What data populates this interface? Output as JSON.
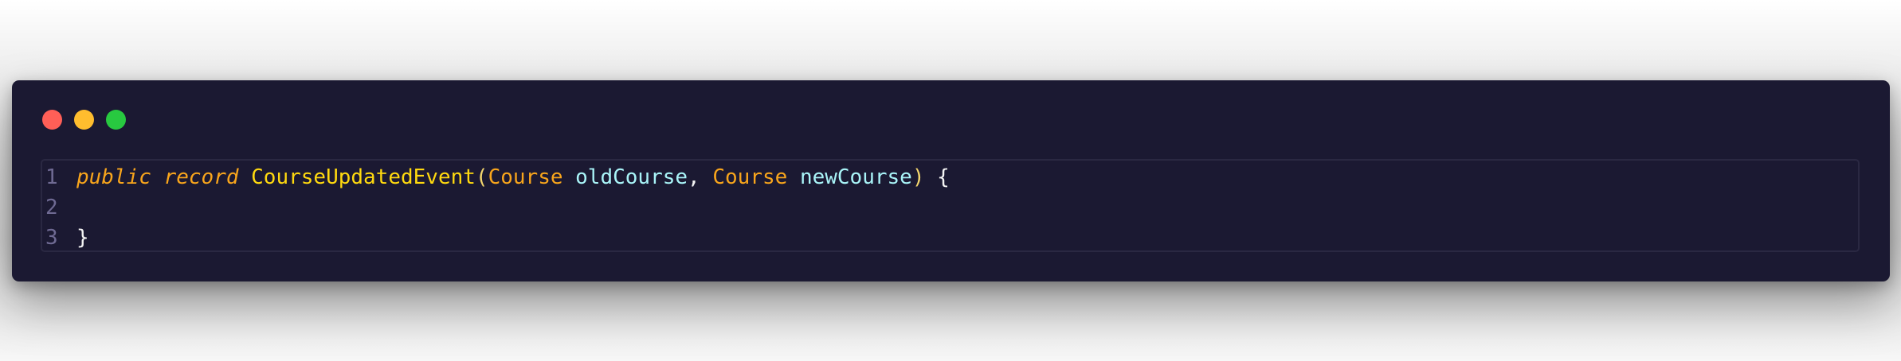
{
  "window": {
    "controls": [
      {
        "name": "close",
        "color": "#ff5f57"
      },
      {
        "name": "minimize",
        "color": "#ffbd2e"
      },
      {
        "name": "zoom",
        "color": "#28c940"
      }
    ]
  },
  "colors": {
    "window_bg": "#1b1932",
    "line_number": "#6f6a93",
    "keyword": "#f8a51c",
    "class_name": "#ffd90f",
    "type": "#f8a51c",
    "param": "#a9f4f8",
    "punct": "#f5d76e",
    "text": "#f4f4f4"
  },
  "code": {
    "lines": [
      {
        "number": "1",
        "tokens": {
          "kw_public": "public",
          "sp1": " ",
          "kw_record": "record",
          "sp2": " ",
          "class_name": "CourseUpdatedEvent",
          "paren_open": "(",
          "type1": "Course",
          "sp3": " ",
          "param1": "oldCourse",
          "comma": ",",
          "sp4": " ",
          "type2": "Course",
          "sp5": " ",
          "param2": "newCourse",
          "paren_close": ")",
          "sp6": " ",
          "brace_open": "{"
        }
      },
      {
        "number": "2",
        "tokens": {}
      },
      {
        "number": "3",
        "tokens": {
          "brace_close": "}"
        }
      }
    ]
  }
}
